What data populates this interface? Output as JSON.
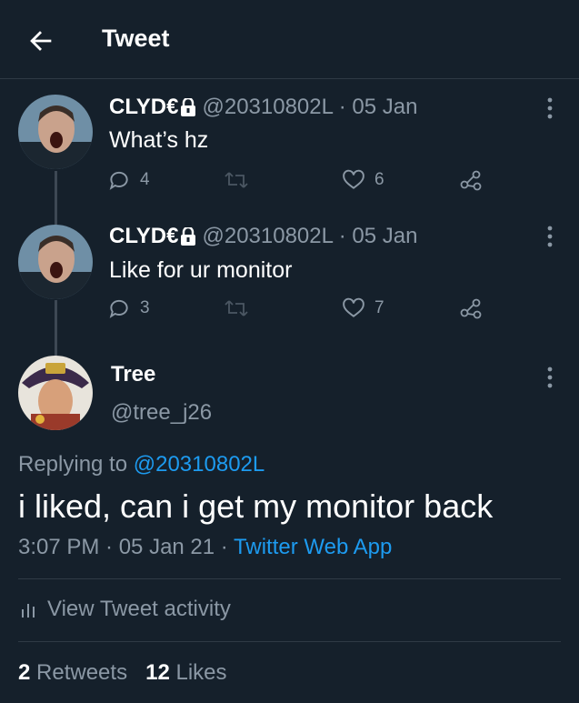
{
  "header": {
    "title": "Tweet",
    "back_icon": "arrow-left-icon"
  },
  "thread": [
    {
      "name": "CLYD€",
      "handle_meta": "@20310802L · 05 Jan",
      "text": "What’s hz",
      "replies": "4",
      "retweets": "",
      "likes": "6"
    },
    {
      "name": "CLYD€",
      "handle_meta": "@20310802L · 05 Jan",
      "text": "Like for ur monitor",
      "replies": "3",
      "retweets": "",
      "likes": "7"
    }
  ],
  "main": {
    "name": "Tree",
    "handle": "@tree_j26",
    "replying_prefix": "Replying to",
    "replying_to": "@20310802L",
    "text": "i liked, can i get my monitor back",
    "time": "3:07 PM · 05 Jan 21 ·",
    "source": "Twitter Web App",
    "activity_label": "View Tweet activity",
    "retweets_count": "2",
    "retweets_label": "Retweets",
    "likes_count": "12",
    "likes_label": "Likes"
  },
  "colors": {
    "background": "#15202b",
    "secondary_text": "#8b98a5",
    "link": "#1d9bf0"
  }
}
